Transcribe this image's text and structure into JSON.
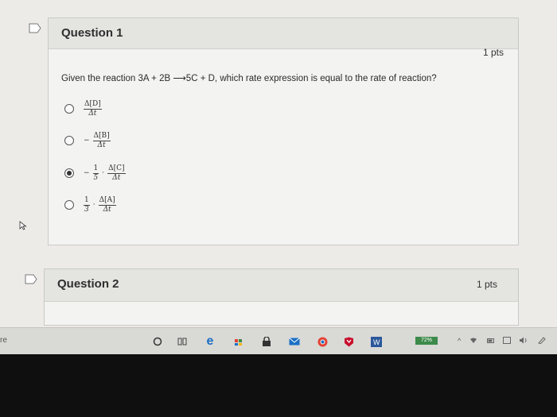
{
  "questions": [
    {
      "title": "Question 1",
      "points": "1 pts",
      "text": "Given the reaction 3A + 2B ⟶5C + D, which rate expression is equal to the rate of reaction?",
      "answers": [
        {
          "prefix": "",
          "coef": "",
          "num": "Δ[D]",
          "den": "Δt",
          "selected": false
        },
        {
          "prefix": "−",
          "coef": "",
          "num": "Δ[B]",
          "den": "Δt",
          "selected": false
        },
        {
          "prefix": "−",
          "coef": "1/5",
          "num": "Δ[C]",
          "den": "Δt",
          "selected": true
        },
        {
          "prefix": "",
          "coef": "1/3",
          "num": "Δ[A]",
          "den": "Δt",
          "selected": false
        }
      ]
    },
    {
      "title": "Question 2",
      "points": "1 pts"
    }
  ],
  "math": {
    "q1a1_num": "Δ[D]",
    "q1a1_den": "Δt",
    "q1a2_prefix": "−",
    "q1a2_num": "Δ[B]",
    "q1a2_den": "Δt",
    "q1a3_prefix": "−",
    "q1a3_cnum": "1",
    "q1a3_cden": "5",
    "q1a3_dot": "·",
    "q1a3_num": "Δ[C]",
    "q1a3_den": "Δt",
    "q1a4_cnum": "1",
    "q1a4_cden": "3",
    "q1a4_dot": "·",
    "q1a4_num": "Δ[A]",
    "q1a4_den": "Δt"
  },
  "taskbar": {
    "search_stub": "re",
    "battery": "72%",
    "icons": [
      "cortana-icon",
      "task-view-icon",
      "edge-icon",
      "store-icon",
      "lock-icon",
      "mail-icon",
      "chrome-icon",
      "mcafee-icon",
      "word-icon"
    ]
  },
  "colors": {
    "battery": "#3d8a4a",
    "edge": "#1a6fc4",
    "word": "#2b579a",
    "chrome": "#e34234"
  }
}
